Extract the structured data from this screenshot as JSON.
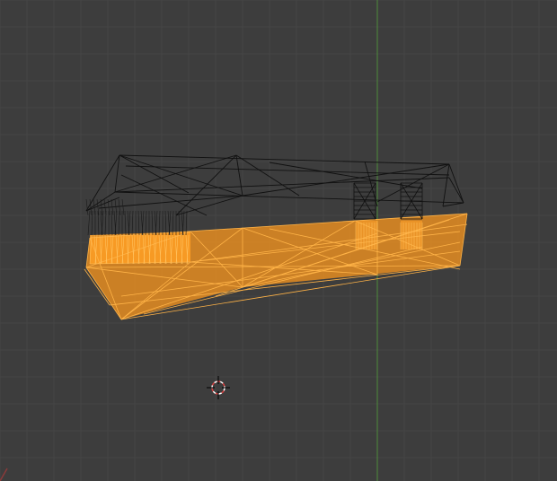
{
  "viewport": {
    "view": "3d-viewport",
    "shading": "wireframe",
    "grid": true
  },
  "colors": {
    "background": "#3d3d3d",
    "grid_minor": "#444444",
    "grid_major": "#4a4a4a",
    "y_axis": "#4d8a3a",
    "x_axis": "#8a3a3a",
    "selected_wire": "#ff9d1c",
    "selected_fill": "#f3941f",
    "unselected_wire": "#111111",
    "cursor_red": "#d84040",
    "cursor_white": "#ffffff"
  },
  "selection": {
    "selected_object": "lower-hull",
    "unselected_object": "upper-frame"
  },
  "icons": {
    "cursor": "3d-cursor-icon"
  }
}
